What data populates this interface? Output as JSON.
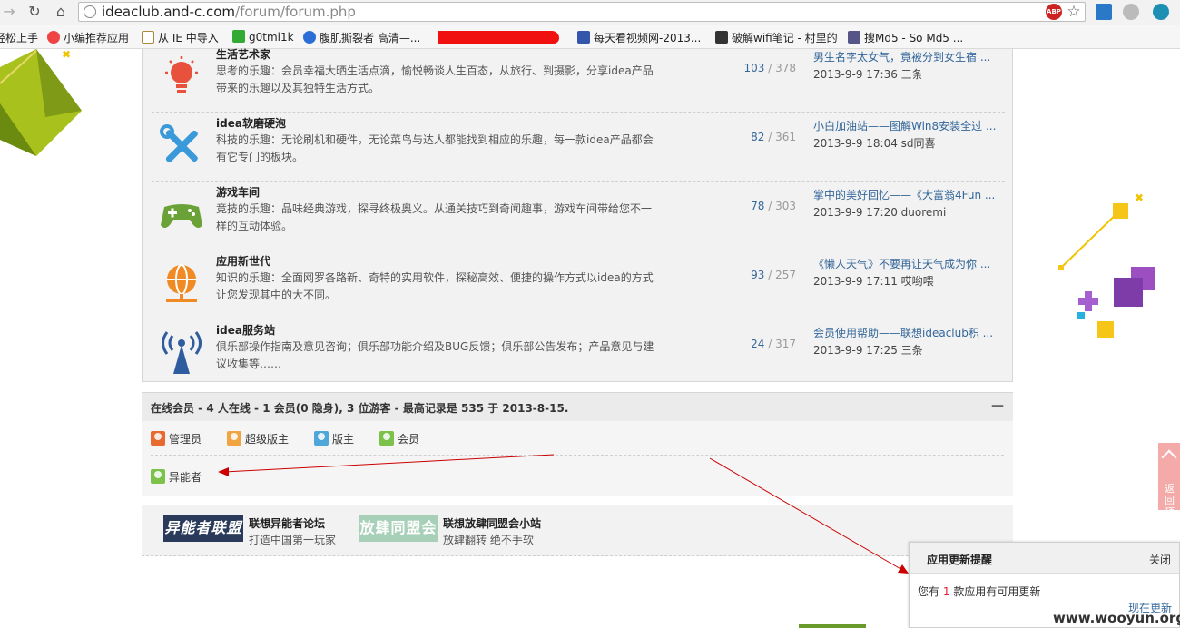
{
  "browser": {
    "url_host": "ideaclub.and-c.com",
    "url_path": "/forum/forum.php"
  },
  "bookmarks": [
    {
      "label": "轻松上手",
      "color": "#4a9"
    },
    {
      "label": "小编推荐应用",
      "color": "#e44"
    },
    {
      "label": "从 IE 中导入",
      "color": "#d9b04a"
    },
    {
      "label": "g0tmi1k",
      "color": "#3a3"
    },
    {
      "label": "腹肌撕裂者 高清—...",
      "color": "#2b6fd6"
    },
    {
      "label": "每天看视频网-2013...",
      "color": "#35a"
    },
    {
      "label": "破解wifi笔记 - 村里的",
      "color": "#333"
    },
    {
      "label": "搜Md5 - So Md5 ...",
      "color": "#558"
    }
  ],
  "forums": [
    {
      "title": "生活艺术家",
      "desc": "思考的乐趣：会员幸福大晒生活点滴，愉悦畅谈人生百态，从旅行、到摄影，分享idea产品带来的乐趣以及其独特生活方式。",
      "threads": "103",
      "posts": "378",
      "last_title": "男生名字太女气，竟被分到女生宿 ...",
      "last_meta": "2013-9-9 17:36 三条",
      "icon": "lightbulb-icon",
      "icon_color": "#e8513b"
    },
    {
      "title": "idea软磨硬泡",
      "desc": "科技的乐趣：无论刷机和硬件，无论菜鸟与达人都能找到相应的乐趣，每一款idea产品都会有它专门的板块。",
      "threads": "82",
      "posts": "361",
      "last_title": "小白加油站——图解Win8安装全过 ...",
      "last_meta": "2013-9-9 18:04 sd同喜",
      "icon": "tools-icon",
      "icon_color": "#3a9ad9"
    },
    {
      "title": "游戏车间",
      "desc": "竞技的乐趣：品味经典游戏，探寻终极奥义。从通关技巧到奇闻趣事，游戏车间带给您不一样的互动体验。",
      "threads": "78",
      "posts": "303",
      "last_title": "掌中的美好回忆——《大富翁4Fun ...",
      "last_meta": "2013-9-9 17:20 duoremi",
      "icon": "gamepad-icon",
      "icon_color": "#6aa237"
    },
    {
      "title": "应用新世代",
      "desc": "知识的乐趣：全面网罗各路新、奇特的实用软件，探秘高效、便捷的操作方式以idea的方式让您发现其中的大不同。",
      "threads": "93",
      "posts": "257",
      "last_title": "《懒人天气》不要再让天气成为你 ...",
      "last_meta": "2013-9-9 17:11 哎哟喂",
      "icon": "globe-network-icon",
      "icon_color": "#f08a24"
    },
    {
      "title": "idea服务站",
      "desc": "俱乐部操作指南及意见咨询；俱乐部功能介绍及BUG反馈；俱乐部公告发布；产品意见与建议收集等……",
      "threads": "24",
      "posts": "317",
      "last_title": "会员使用帮助——联想ideaclub积 ...",
      "last_meta": "2013-9-9 17:25 三条",
      "icon": "antenna-icon",
      "icon_color": "#2f5c9e"
    }
  ],
  "online": {
    "summary": "在线会员 - 4 人在线 - 1 会员(0 隐身), 3 位游客 - 最高记录是 535 于 2013-8-15.",
    "collapse": "—",
    "groups": [
      {
        "label": "管理员",
        "color": "#e86a2f"
      },
      {
        "label": "超级版主",
        "color": "#f0a542"
      },
      {
        "label": "版主",
        "color": "#4fa6d8"
      },
      {
        "label": "会员",
        "color": "#7cc24a"
      },
      {
        "label": "异能者",
        "color": "#7cc24a"
      }
    ]
  },
  "links": [
    {
      "banner": "异能者联盟",
      "title": "联想异能者论坛",
      "sub": "打造中国第一玩家",
      "color": "#2a3a5a"
    },
    {
      "banner": "放肆同盟会",
      "title": "联想放肆同盟会小站",
      "sub": "放肆翻转 绝不手软",
      "color": "#a8d0b8"
    }
  ],
  "popup": {
    "title": "应用更新提醒",
    "close": "关闭",
    "msg_pre": "您有",
    "msg_count": "1",
    "msg_post": "款应用有可用更新",
    "link": "现在更新"
  },
  "backtop": "返回顶部",
  "watermark": "www.wooyun.org"
}
